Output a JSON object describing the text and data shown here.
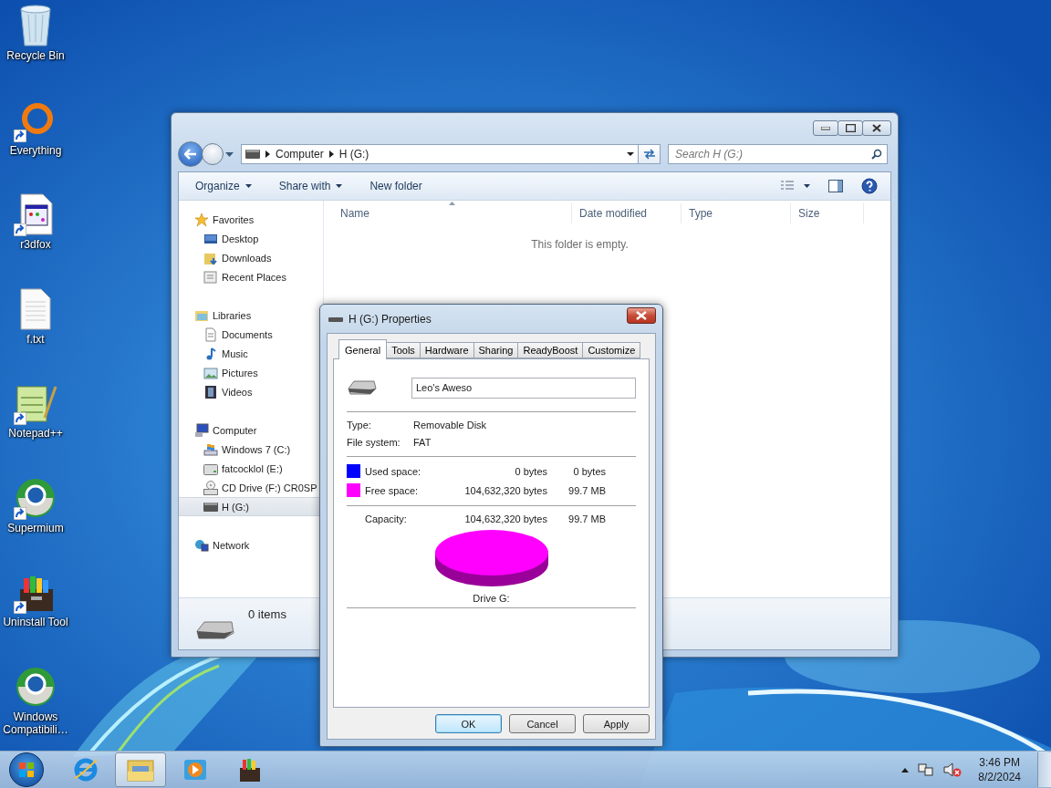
{
  "desktop_icons": [
    {
      "label": "Recycle Bin",
      "kind": "bin",
      "shortcut": false
    },
    {
      "label": "Everything",
      "kind": "ring",
      "shortcut": true
    },
    {
      "label": "r3dfox",
      "kind": "app",
      "shortcut": true
    },
    {
      "label": "f.txt",
      "kind": "text",
      "shortcut": false
    },
    {
      "label": "Notepad++",
      "kind": "notepad",
      "shortcut": true
    },
    {
      "label": "Supermium",
      "kind": "globe",
      "shortcut": true
    },
    {
      "label": "Uninstall Tool",
      "kind": "toolbox",
      "shortcut": true
    },
    {
      "label": "Windows Compatibili…",
      "kind": "globe",
      "shortcut": false
    }
  ],
  "explorer": {
    "breadcrumb": [
      "Computer",
      "H (G:)"
    ],
    "search": {
      "placeholder": "Search H (G:)"
    },
    "toolbar": [
      {
        "label": "Organize",
        "dropdown": true
      },
      {
        "label": "Share with",
        "dropdown": true
      },
      {
        "label": "New folder",
        "dropdown": false
      }
    ],
    "sidebar": [
      {
        "label": "Favorites",
        "kind": "star",
        "selected": false,
        "children": [
          {
            "label": "Desktop",
            "kind": "desktop",
            "selected": false
          },
          {
            "label": "Downloads",
            "kind": "downloads",
            "selected": false
          },
          {
            "label": "Recent Places",
            "kind": "recent",
            "selected": false
          }
        ]
      },
      {
        "label": "Libraries",
        "kind": "library",
        "selected": false,
        "children": [
          {
            "label": "Documents",
            "kind": "doc",
            "selected": false
          },
          {
            "label": "Music",
            "kind": "music",
            "selected": false
          },
          {
            "label": "Pictures",
            "kind": "pictures",
            "selected": false
          },
          {
            "label": "Videos",
            "kind": "videos",
            "selected": false
          }
        ]
      },
      {
        "label": "Computer",
        "kind": "computer",
        "selected": false,
        "children": [
          {
            "label": "Windows 7 (C:)",
            "kind": "windrive",
            "selected": false
          },
          {
            "label": "fatcocklol (E:)",
            "kind": "drive",
            "selected": false
          },
          {
            "label": "CD Drive (F:) CR0SP",
            "kind": "cd",
            "selected": false
          },
          {
            "label": "H (G:)",
            "kind": "usb",
            "selected": true
          }
        ]
      },
      {
        "label": "Network",
        "kind": "network",
        "selected": false
      }
    ],
    "columns": [
      "Name",
      "Date modified",
      "Type",
      "Size"
    ],
    "empty_message": "This folder is empty.",
    "status": "0 items"
  },
  "dialog": {
    "title": "H (G:) Properties",
    "tabs": [
      {
        "label": "General",
        "selected": true
      },
      {
        "label": "Tools",
        "selected": false
      },
      {
        "label": "Hardware",
        "selected": false
      },
      {
        "label": "Sharing",
        "selected": false
      },
      {
        "label": "ReadyBoost",
        "selected": false
      },
      {
        "label": "Customize",
        "selected": false
      }
    ],
    "name_field": {
      "value": "Leo's Aweso"
    },
    "info": [
      {
        "label": "Type:",
        "value": "Removable Disk"
      },
      {
        "label": "File system:",
        "value": "FAT"
      }
    ],
    "space": [
      {
        "label": "Used space:",
        "bytes": "0 bytes",
        "size": "0 bytes",
        "color": "#0000ff"
      },
      {
        "label": "Free space:",
        "bytes": "104,632,320 bytes",
        "size": "99.7 MB",
        "color": "#ff00ff"
      }
    ],
    "capacity": {
      "label": "Capacity:",
      "bytes": "104,632,320 bytes",
      "size": "99.7 MB"
    },
    "drive_label": "Drive G:",
    "buttons": [
      {
        "label": "OK",
        "default": true
      },
      {
        "label": "Cancel",
        "default": false
      },
      {
        "label": "Apply",
        "default": false
      }
    ]
  },
  "taskbar": {
    "apps": [
      {
        "kind": "ie",
        "active": false
      },
      {
        "kind": "explorer",
        "active": true
      },
      {
        "kind": "media",
        "active": false
      },
      {
        "kind": "toolbox",
        "active": false
      }
    ],
    "time": "3:46 PM",
    "date": "8/2/2024"
  }
}
